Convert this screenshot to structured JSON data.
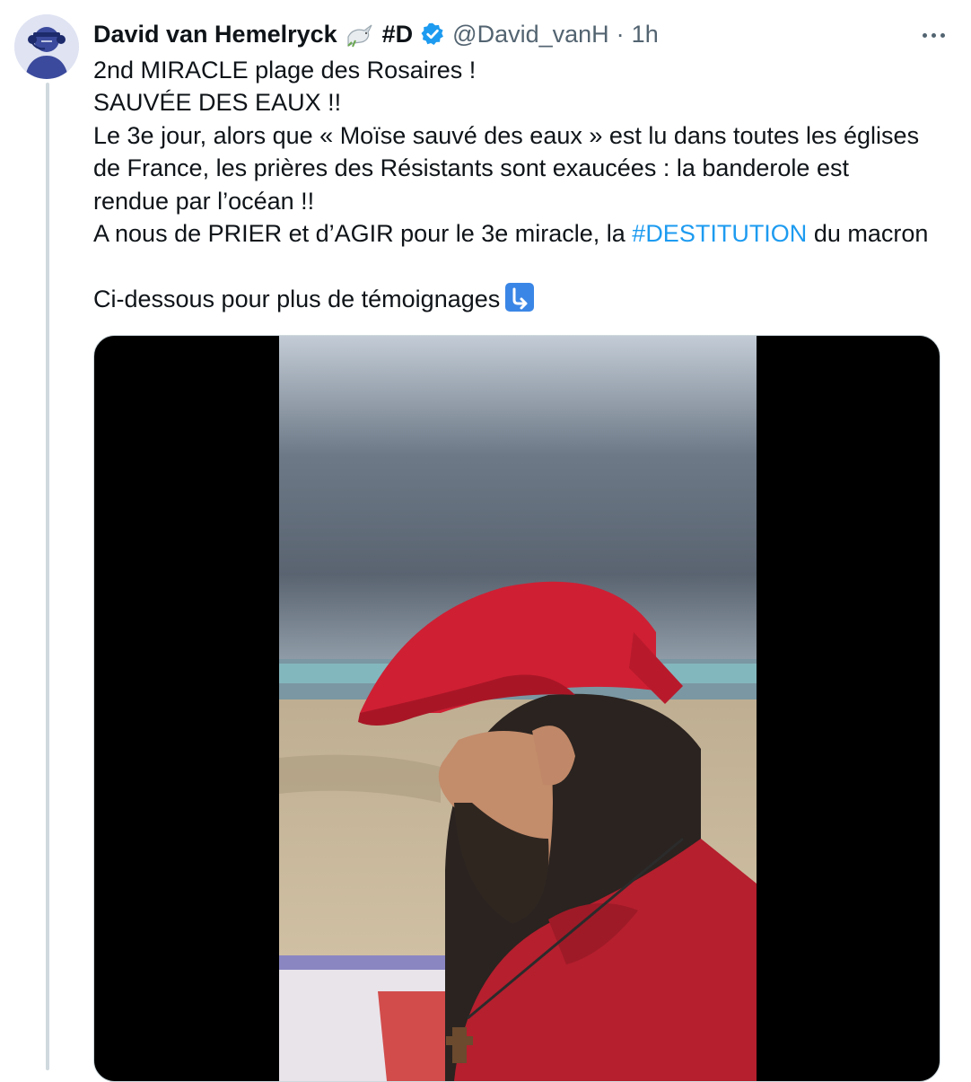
{
  "tweet": {
    "author_name": "David van Hemelryck",
    "name_suffix": "#D",
    "handle": "@David_vanH",
    "separator": "·",
    "time": "1h",
    "lines": [
      "2nd MIRACLE plage des Rosaires !",
      "SAUVÉE DES EAUX !!",
      "Le 3e jour, alors que « Moïse sauvé des eaux » est lu dans toutes les églises",
      "de France, les prières des Résistants sont exaucées : la banderole est",
      "rendue par l’océan !!"
    ],
    "line6_before": "A nous de PRIER et d’AGIR pour le 3e miracle, la ",
    "hashtag": "#DESTITUTION",
    "line6_after": " du macron",
    "line8": "Ci-dessous pour plus de témoignages",
    "emoji_name": "arrow-down-right-icon"
  },
  "icons": {
    "more": "more-horizontal-icon",
    "verified": "verified-badge-icon",
    "dove": "dove-emoji-icon"
  },
  "colors": {
    "link": "#1d9bf0",
    "secondary_text": "#536471",
    "verified": "#1d9bf0",
    "cap": "#cf1f33",
    "shirt": "#b51f2e"
  }
}
